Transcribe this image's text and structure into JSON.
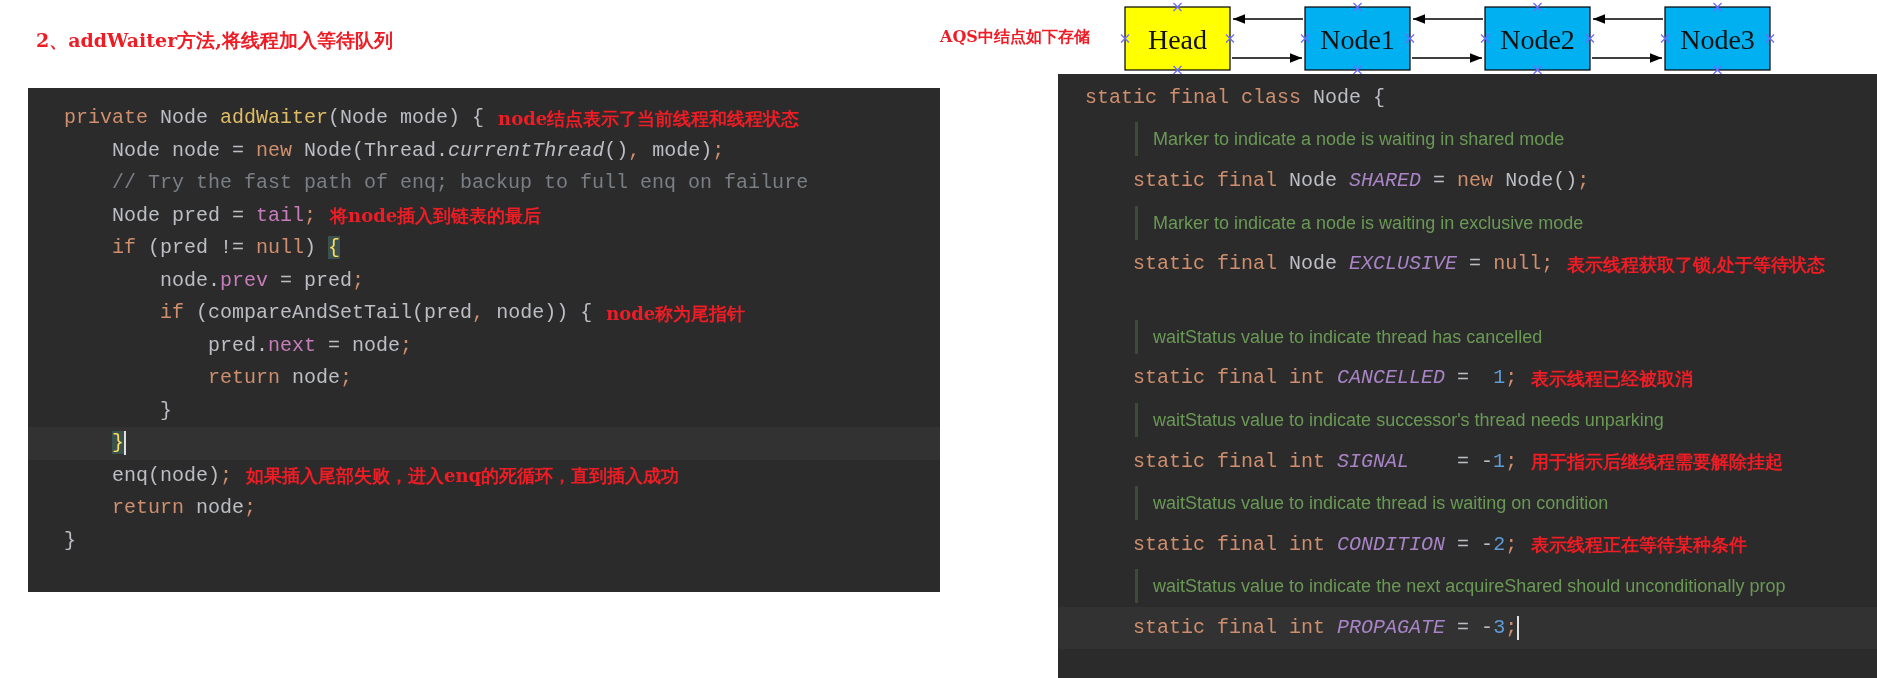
{
  "left": {
    "title": "2、addWaiter方法,将线程加入等待队列",
    "lines": [
      {
        "current": false,
        "tokens": [
          {
            "kind": "keyword",
            "text": "private"
          },
          {
            "kind": "plain",
            "text": " Node "
          },
          {
            "kind": "method",
            "text": "addWaiter"
          },
          {
            "kind": "plain",
            "text": "(Node mode) {"
          }
        ],
        "note": "node结点表示了当前线程和线程状态"
      },
      {
        "current": false,
        "tokens": [
          {
            "kind": "plain",
            "text": "    Node node = "
          },
          {
            "kind": "keyword",
            "text": "new"
          },
          {
            "kind": "plain",
            "text": " Node(Thread."
          },
          {
            "kind": "static-call",
            "text": "currentThread"
          },
          {
            "kind": "plain",
            "text": "()"
          },
          {
            "kind": "punct",
            "text": ","
          },
          {
            "kind": "plain",
            "text": " mode)"
          },
          {
            "kind": "punct",
            "text": ";"
          }
        ]
      },
      {
        "current": false,
        "tokens": [
          {
            "kind": "comment",
            "text": "    // Try the fast path of enq; backup to full enq on failure"
          }
        ]
      },
      {
        "current": false,
        "tokens": [
          {
            "kind": "plain",
            "text": "    Node pred = "
          },
          {
            "kind": "field",
            "text": "tail"
          },
          {
            "kind": "punct",
            "text": ";"
          }
        ],
        "note": "将node插入到链表的最后"
      },
      {
        "current": false,
        "tokens": [
          {
            "kind": "keyword",
            "text": "    if"
          },
          {
            "kind": "plain",
            "text": " (pred != "
          },
          {
            "kind": "keyword",
            "text": "null"
          },
          {
            "kind": "plain",
            "text": ") "
          },
          {
            "kind": "brace-match",
            "text": "{"
          }
        ]
      },
      {
        "current": false,
        "tokens": [
          {
            "kind": "plain",
            "text": "        node."
          },
          {
            "kind": "field",
            "text": "prev"
          },
          {
            "kind": "plain",
            "text": " = pred"
          },
          {
            "kind": "punct",
            "text": ";"
          }
        ]
      },
      {
        "current": false,
        "tokens": [
          {
            "kind": "keyword",
            "text": "        if"
          },
          {
            "kind": "plain",
            "text": " (compareAndSetTail(pred"
          },
          {
            "kind": "punct",
            "text": ","
          },
          {
            "kind": "plain",
            "text": " node)) {"
          }
        ],
        "note": "node称为尾指针"
      },
      {
        "current": false,
        "tokens": [
          {
            "kind": "plain",
            "text": "            pred."
          },
          {
            "kind": "field",
            "text": "next"
          },
          {
            "kind": "plain",
            "text": " = node"
          },
          {
            "kind": "punct",
            "text": ";"
          }
        ]
      },
      {
        "current": false,
        "tokens": [
          {
            "kind": "keyword",
            "text": "            return"
          },
          {
            "kind": "plain",
            "text": " node"
          },
          {
            "kind": "punct",
            "text": ";"
          }
        ]
      },
      {
        "current": false,
        "tokens": [
          {
            "kind": "plain",
            "text": "        }"
          }
        ]
      },
      {
        "current": true,
        "tokens": [
          {
            "kind": "brace-match",
            "text": "    }"
          }
        ]
      },
      {
        "current": false,
        "tokens": [
          {
            "kind": "plain",
            "text": "    enq(node)"
          },
          {
            "kind": "punct",
            "text": ";"
          }
        ],
        "note": "如果插入尾部失败，进入enq的死循环，直到插入成功"
      },
      {
        "current": false,
        "tokens": [
          {
            "kind": "keyword",
            "text": "    return"
          },
          {
            "kind": "plain",
            "text": " node"
          },
          {
            "kind": "punct",
            "text": ";"
          }
        ]
      },
      {
        "current": false,
        "tokens": [
          {
            "kind": "plain",
            "text": "}"
          }
        ]
      }
    ]
  },
  "diagram": {
    "label": "AQS中结点如下存储",
    "nodes": [
      {
        "label": "Head",
        "color": "#ffff00"
      },
      {
        "label": "Node1",
        "color": "#00b0f0"
      },
      {
        "label": "Node2",
        "color": "#00b0f0"
      },
      {
        "label": "Node3",
        "color": "#00b0f0"
      }
    ]
  },
  "right": {
    "lines": [
      {
        "kind": "code",
        "current": false,
        "tokens": [
          {
            "kind": "keyword",
            "text": "static final class "
          },
          {
            "kind": "plain",
            "text": "Node {"
          }
        ]
      },
      {
        "kind": "doc",
        "text": "Marker to indicate a node is waiting in shared mode"
      },
      {
        "kind": "code",
        "current": false,
        "tokens": [
          {
            "kind": "keyword",
            "text": "    static final "
          },
          {
            "kind": "plain",
            "text": "Node "
          },
          {
            "kind": "const",
            "text": "SHARED"
          },
          {
            "kind": "plain",
            "text": " = "
          },
          {
            "kind": "keyword",
            "text": "new"
          },
          {
            "kind": "plain",
            "text": " Node()"
          },
          {
            "kind": "punct",
            "text": ";"
          }
        ]
      },
      {
        "kind": "doc",
        "text": "Marker to indicate a node is waiting in exclusive mode"
      },
      {
        "kind": "code",
        "current": false,
        "tokens": [
          {
            "kind": "keyword",
            "text": "    static final "
          },
          {
            "kind": "plain",
            "text": "Node "
          },
          {
            "kind": "const",
            "text": "EXCLUSIVE"
          },
          {
            "kind": "plain",
            "text": " = "
          },
          {
            "kind": "keyword",
            "text": "null"
          },
          {
            "kind": "punct",
            "text": ";"
          }
        ],
        "note": "表示线程获取了锁,处于等待状态"
      },
      {
        "kind": "blank"
      },
      {
        "kind": "doc",
        "text": "waitStatus value to indicate thread has cancelled"
      },
      {
        "kind": "code",
        "current": false,
        "tokens": [
          {
            "kind": "keyword",
            "text": "    static final int "
          },
          {
            "kind": "const",
            "text": "CANCELLED"
          },
          {
            "kind": "plain",
            "text": " =  "
          },
          {
            "kind": "number",
            "text": "1"
          },
          {
            "kind": "punct",
            "text": ";"
          }
        ],
        "note": "表示线程已经被取消"
      },
      {
        "kind": "doc",
        "text": "waitStatus value to indicate successor's thread needs unparking"
      },
      {
        "kind": "code",
        "current": false,
        "tokens": [
          {
            "kind": "keyword",
            "text": "    static final int "
          },
          {
            "kind": "const",
            "text": "SIGNAL"
          },
          {
            "kind": "plain",
            "text": "    = -"
          },
          {
            "kind": "number",
            "text": "1"
          },
          {
            "kind": "punct",
            "text": ";"
          }
        ],
        "note": "用于指示后继线程需要解除挂起"
      },
      {
        "kind": "doc",
        "text": "waitStatus value to indicate thread is waiting on condition"
      },
      {
        "kind": "code",
        "current": false,
        "tokens": [
          {
            "kind": "keyword",
            "text": "    static final int "
          },
          {
            "kind": "const",
            "text": "CONDITION"
          },
          {
            "kind": "plain",
            "text": " = -"
          },
          {
            "kind": "number",
            "text": "2"
          },
          {
            "kind": "punct",
            "text": ";"
          }
        ],
        "note": "表示线程正在等待某种条件"
      },
      {
        "kind": "doc",
        "text": "waitStatus value to indicate the next acquireShared should unconditionally prop"
      },
      {
        "kind": "code",
        "current": true,
        "tokens": [
          {
            "kind": "keyword",
            "text": "    static final int "
          },
          {
            "kind": "const",
            "text": "PROPAGATE"
          },
          {
            "kind": "plain",
            "text": " = -"
          },
          {
            "kind": "number",
            "text": "3"
          },
          {
            "kind": "punct",
            "text": ";"
          }
        ]
      }
    ]
  }
}
